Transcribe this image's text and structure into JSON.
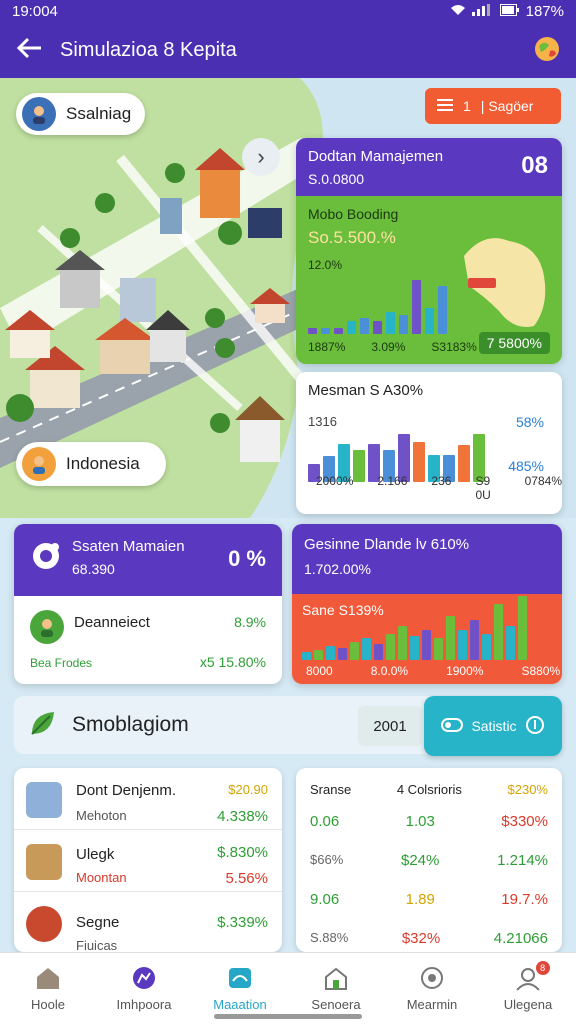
{
  "status": {
    "time": "19:004",
    "battery": "187%"
  },
  "header": {
    "title": "Simulazioa 8 Kepita"
  },
  "map": {
    "top_chip": "Ssalniag",
    "bottom_chip": "Indonesia",
    "filter_btn": "| Sagöer",
    "filter_num": "1"
  },
  "card_top_right": {
    "title": "Dodtan Mamajemen",
    "sub": "S.0.0800",
    "badge": "08",
    "green_title": "Mobo Booding",
    "green_value": "So.5.500.%",
    "green_pct": "12.0%",
    "map_tag": "",
    "labels": [
      "1887%",
      "3.09%",
      "S3183%"
    ],
    "right_pill": "7 5800%",
    "bars": [
      4,
      4,
      4,
      8,
      10,
      8,
      14,
      12,
      34,
      16,
      30
    ]
  },
  "card_mid_right": {
    "title": "Mesman S A30%",
    "left_num": "1316",
    "right_top": "58%",
    "right_mid": "485%",
    "labels": [
      "2000%",
      "2.166",
      "236",
      "S9 0U",
      "0784%"
    ],
    "bars": [
      {
        "v": 22,
        "c": "#6f52c8"
      },
      {
        "v": 32,
        "c": "#4b8fd8"
      },
      {
        "v": 48,
        "c": "#27b3c8"
      },
      {
        "v": 40,
        "c": "#6bbd3c"
      },
      {
        "v": 48,
        "c": "#6f52c8"
      },
      {
        "v": 40,
        "c": "#4b8fd8"
      },
      {
        "v": 60,
        "c": "#6f52c8"
      },
      {
        "v": 50,
        "c": "#f0743a"
      },
      {
        "v": 34,
        "c": "#27b3c8"
      },
      {
        "v": 34,
        "c": "#4b8fd8"
      },
      {
        "v": 46,
        "c": "#f0743a"
      },
      {
        "v": 60,
        "c": "#6bbd3c"
      }
    ]
  },
  "card_left_mid": {
    "title": "Ssaten Mamaien",
    "sub": "68.390",
    "badge": "0 %",
    "row_name": "Deanneiect",
    "row_pct": "8.9%",
    "row_foot_left": "Bea Frodes",
    "row_foot_right": "x5 15.80%"
  },
  "card_right_mid2": {
    "title": "Gesinne Dlande lv 610%",
    "sub": "1.702.00%",
    "red_title": "Sane S139%",
    "labels": [
      "8000",
      "8.0.0%",
      "1900%",
      "S880%"
    ],
    "bars": [
      {
        "v": 8,
        "c": "#27b3c8"
      },
      {
        "v": 10,
        "c": "#6bbd3c"
      },
      {
        "v": 14,
        "c": "#27b3c8"
      },
      {
        "v": 12,
        "c": "#6f52c8"
      },
      {
        "v": 18,
        "c": "#6bbd3c"
      },
      {
        "v": 22,
        "c": "#27b3c8"
      },
      {
        "v": 16,
        "c": "#6f52c8"
      },
      {
        "v": 26,
        "c": "#6bbd3c"
      },
      {
        "v": 34,
        "c": "#6bbd3c"
      },
      {
        "v": 24,
        "c": "#27b3c8"
      },
      {
        "v": 30,
        "c": "#6f52c8"
      },
      {
        "v": 22,
        "c": "#6bbd3c"
      },
      {
        "v": 44,
        "c": "#6bbd3c"
      },
      {
        "v": 30,
        "c": "#27b3c8"
      },
      {
        "v": 40,
        "c": "#6f52c8"
      },
      {
        "v": 26,
        "c": "#27b3c8"
      },
      {
        "v": 56,
        "c": "#6bbd3c"
      },
      {
        "v": 34,
        "c": "#27b3c8"
      },
      {
        "v": 64,
        "c": "#6bbd3c"
      }
    ]
  },
  "section": {
    "title": "Smoblagiom",
    "year": "2001",
    "stat_btn": "Satistic"
  },
  "list_left": [
    {
      "name": "Dont Denjenm.",
      "sub": "Mehoton",
      "v1": "$20.90",
      "v2": "4.338%",
      "v1cls": "gold",
      "v2cls": "pos"
    },
    {
      "name": "Ulegk",
      "sub": "Moontan",
      "v1": "$.830%",
      "v2": "5.56%",
      "v1cls": "pos",
      "v2cls": "neg"
    },
    {
      "name": "Segne",
      "sub": "Fiuicas",
      "v1": "$.339%",
      "v2": "",
      "v1cls": "pos",
      "v2cls": "pos"
    }
  ],
  "list_right": {
    "headers": [
      "Sranse",
      "4 Colsrioris",
      "$230%"
    ],
    "rows": [
      [
        {
          "t": "0.06",
          "c": "pos"
        },
        {
          "t": "1.03",
          "c": "pos"
        },
        {
          "t": "$330%",
          "c": "neg"
        }
      ],
      [
        {
          "t": "$66%",
          "c": "muted"
        },
        {
          "t": "$24%",
          "c": "pos"
        },
        {
          "t": "1.214%",
          "c": "pos"
        }
      ],
      [
        {
          "t": "9.06",
          "c": "pos"
        },
        {
          "t": "1.89",
          "c": "gold"
        },
        {
          "t": "19.7.%",
          "c": "neg"
        }
      ],
      [
        {
          "t": "S.88%",
          "c": "muted"
        },
        {
          "t": "$32%",
          "c": "neg"
        },
        {
          "t": "4.21066",
          "c": "pos"
        }
      ]
    ]
  },
  "nav": [
    {
      "label": "Hoole",
      "icon": "home-icon"
    },
    {
      "label": "Imhpoora",
      "icon": "chart-icon"
    },
    {
      "label": "Maaation",
      "icon": "map-icon",
      "active": true
    },
    {
      "label": "Senoera",
      "icon": "building-icon"
    },
    {
      "label": "Mearmin",
      "icon": "settings-icon"
    },
    {
      "label": "Ulegena",
      "icon": "profile-icon",
      "badge": "8"
    }
  ]
}
